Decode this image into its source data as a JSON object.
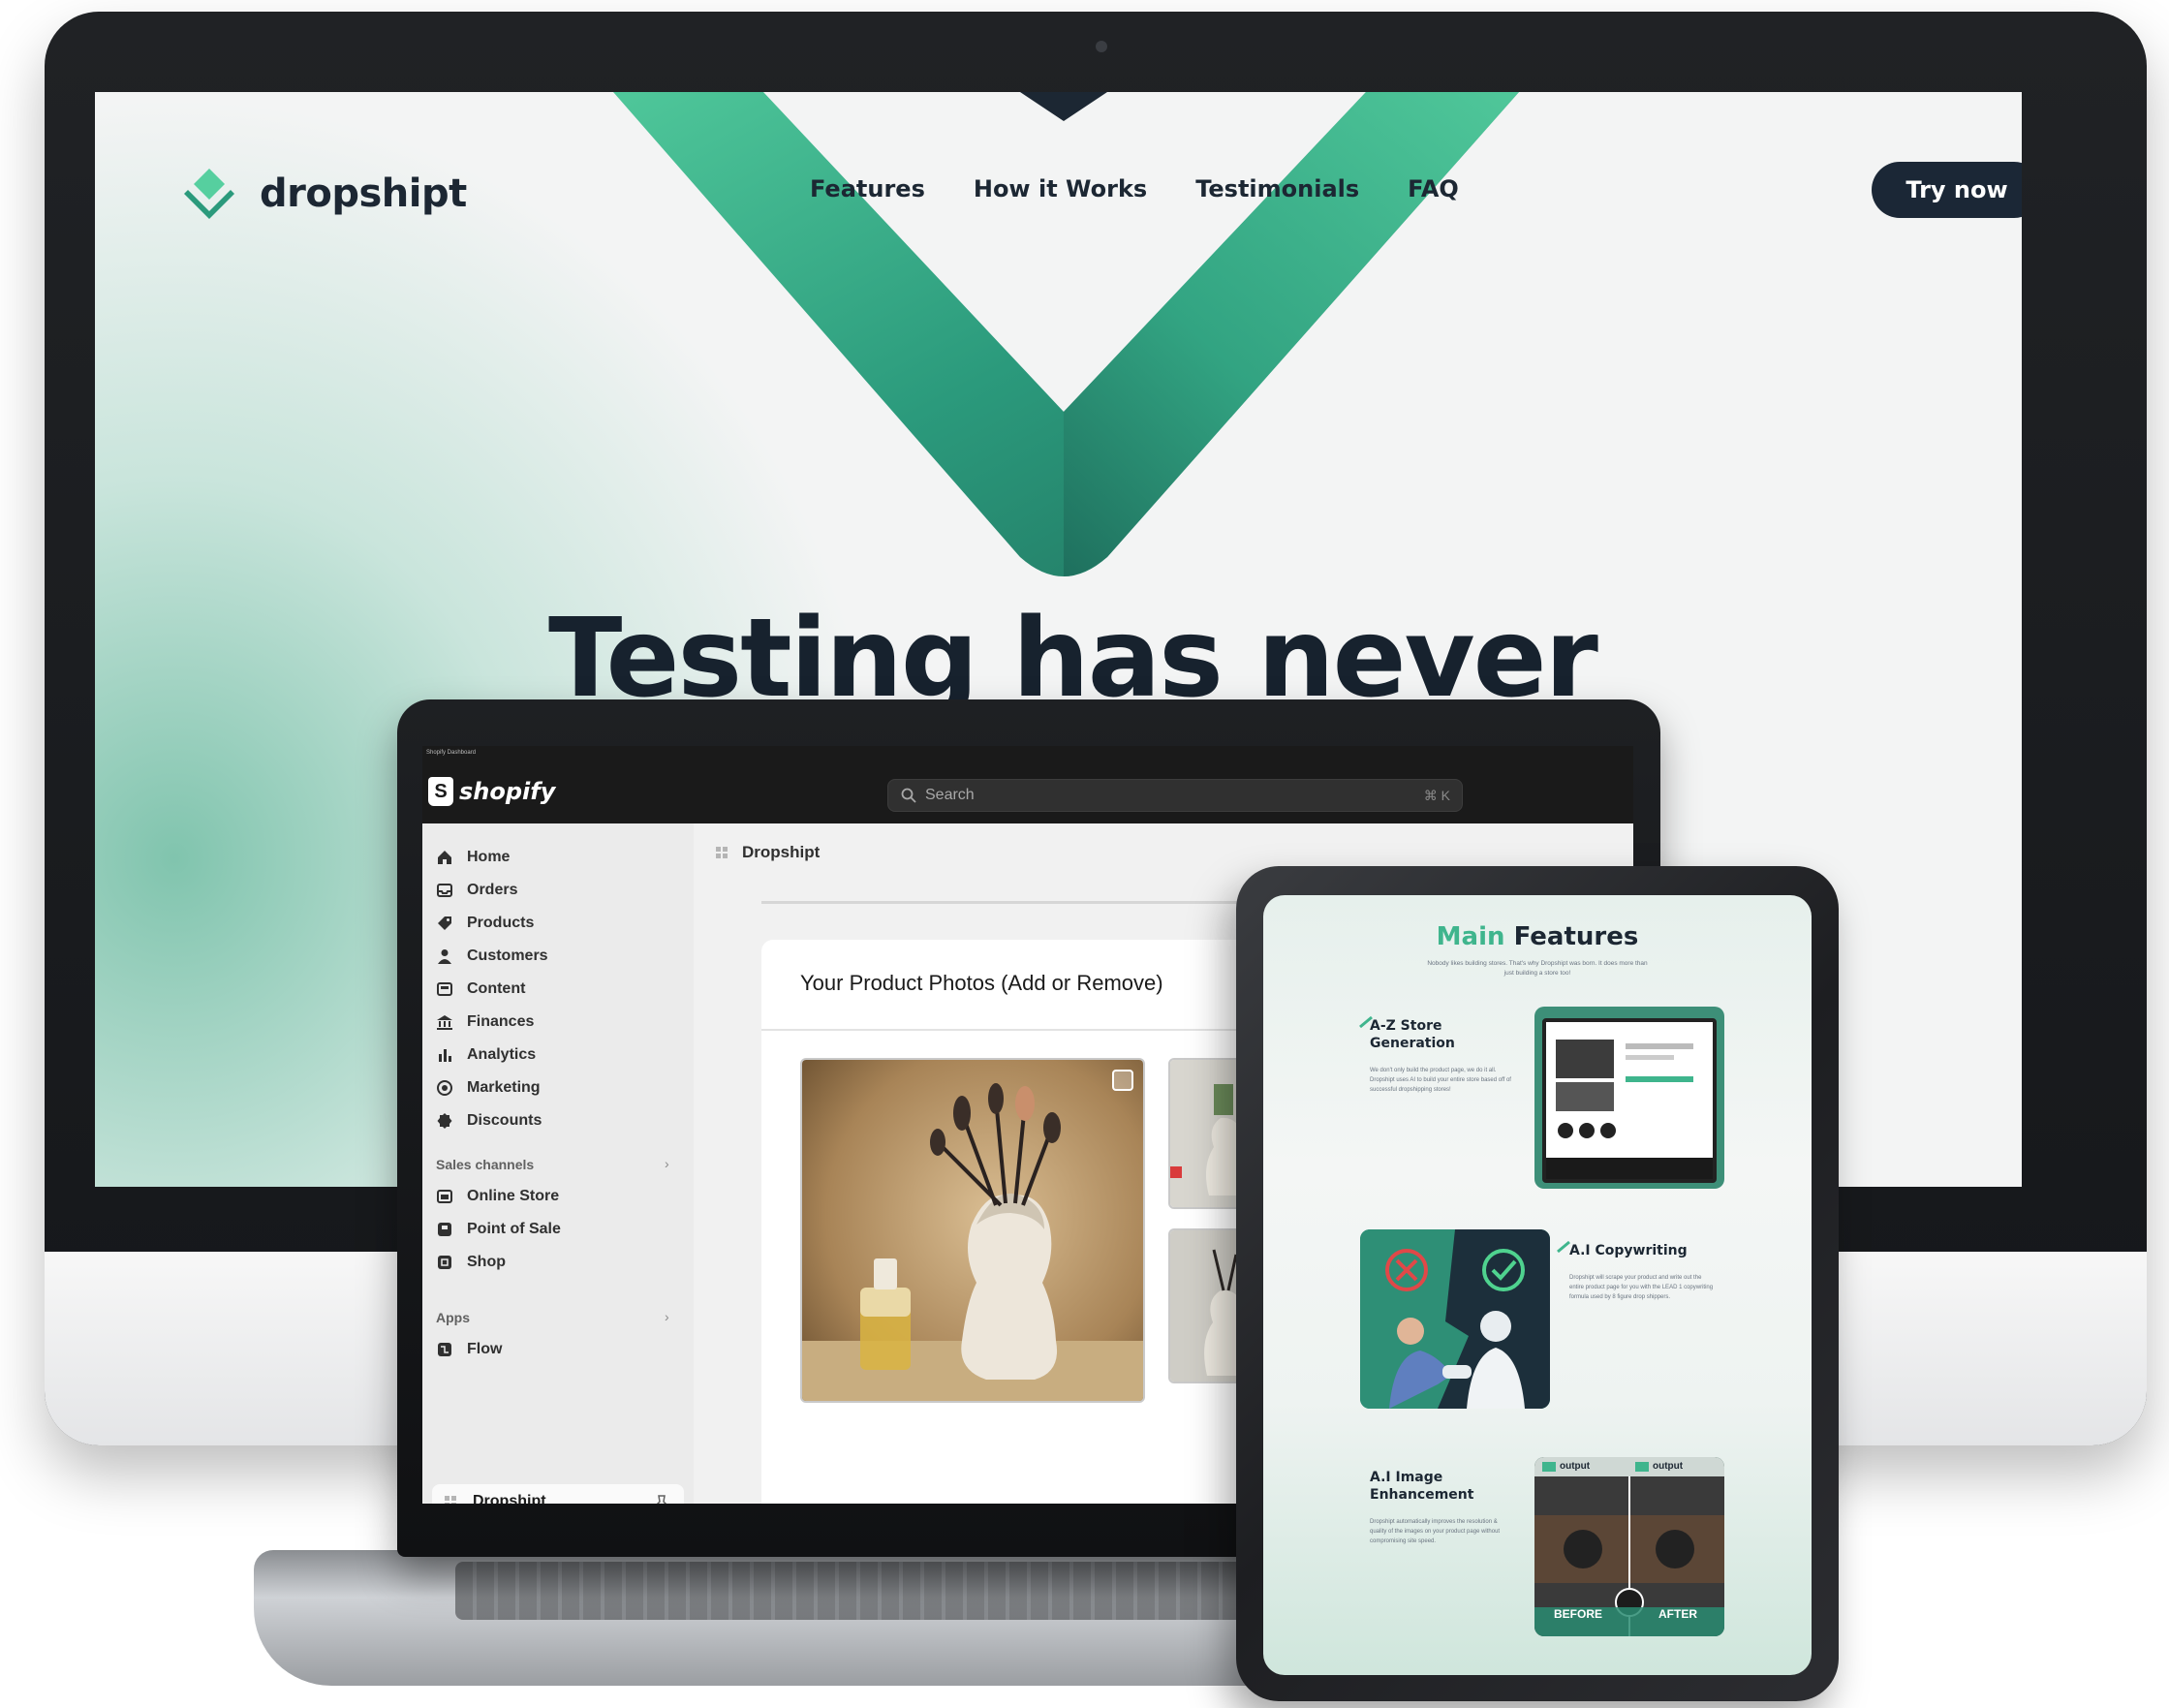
{
  "website": {
    "brand": "dropshipt",
    "nav": [
      "Features",
      "How it Works",
      "Testimonials",
      "FAQ"
    ],
    "cta": "Try now",
    "hero_title": "Testing has never"
  },
  "shopify": {
    "topstrip": "Shopify Dashboard",
    "logo": "shopify",
    "search_placeholder": "Search",
    "search_shortcut": "⌘ K",
    "nav": [
      {
        "label": "Home",
        "icon": "home-icon"
      },
      {
        "label": "Orders",
        "icon": "inbox-icon"
      },
      {
        "label": "Products",
        "icon": "tag-icon"
      },
      {
        "label": "Customers",
        "icon": "person-icon"
      },
      {
        "label": "Content",
        "icon": "content-icon"
      },
      {
        "label": "Finances",
        "icon": "bank-icon"
      },
      {
        "label": "Analytics",
        "icon": "bar-chart-icon"
      },
      {
        "label": "Marketing",
        "icon": "target-icon"
      },
      {
        "label": "Discounts",
        "icon": "discount-icon"
      }
    ],
    "sales_channels_label": "Sales channels",
    "sales_channels": [
      {
        "label": "Online Store",
        "icon": "store-icon"
      },
      {
        "label": "Point of Sale",
        "icon": "pos-icon"
      },
      {
        "label": "Shop",
        "icon": "shop-icon"
      }
    ],
    "apps_label": "Apps",
    "apps": [
      {
        "label": "Flow",
        "icon": "flow-icon"
      }
    ],
    "active_app": "Dropshipt",
    "breadcrumb": "Dropshipt",
    "card_title": "Your Product Photos (Add or Remove)"
  },
  "tablet": {
    "title_accent": "Main",
    "title_rest": "Features",
    "subtitle": "Nobody likes building stores. That's why Dropshipt was born. It does more than just building a store too!",
    "features": [
      {
        "title": "A-Z Store Generation",
        "desc": "We don't only build the product page, we do it all. Dropshipt uses AI to build your entire store based off of successful dropshipping stores!"
      },
      {
        "title": "A.I Copywriting",
        "desc": "Dropshipt will scrape your product and write out the entire product page for you with the LEAD 1 copywriting formula used by 8 figure drop shippers."
      },
      {
        "title": "A.I Image Enhancement",
        "desc": "Dropshipt automatically improves the resolution & quality of the images on your product page without compromising site speed."
      }
    ],
    "before_label": "BEFORE",
    "after_label": "AFTER",
    "output_label": "output"
  },
  "colors": {
    "brand_green": "#3fb58d",
    "brand_dark_green": "#1f6e5c",
    "navy": "#1b2736",
    "shopify_bar": "#1a1a1a"
  }
}
